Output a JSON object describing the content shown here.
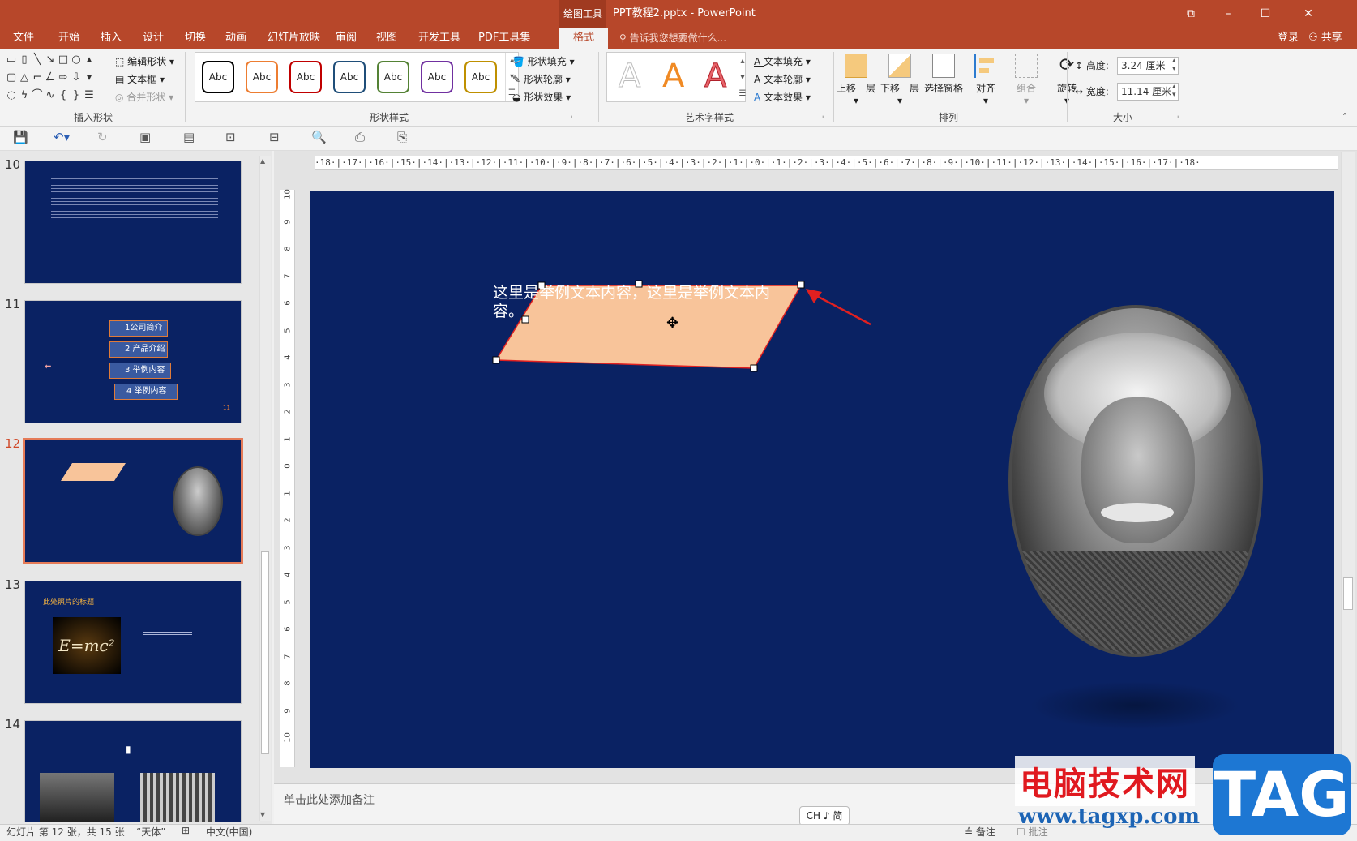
{
  "titlebar": {
    "context_tab": "绘图工具",
    "doc_title": "PPT教程2.pptx - PowerPoint",
    "restore_icon": "ribbon-display-icon",
    "minimize": "–",
    "maximize": "☐",
    "close": "✕"
  },
  "tabs": [
    "文件",
    "开始",
    "插入",
    "设计",
    "切换",
    "动画",
    "幻灯片放映",
    "审阅",
    "视图",
    "开发工具",
    "PDF工具集"
  ],
  "active_tab": "格式",
  "tellme": "告诉我您想要做什么...",
  "login": "登录",
  "share": "共享",
  "ribbon": {
    "insert_shapes": {
      "label": "插入形状",
      "edit_shape": "编辑形状",
      "textbox": "文本框",
      "merge_shapes": "合并形状"
    },
    "shape_styles": {
      "label": "形状样式",
      "sample": "Abc",
      "fill": "形状填充",
      "outline": "形状轮廓",
      "effects": "形状效果",
      "swatch_colors": [
        "#000000",
        "#ed7d31",
        "#c00000",
        "#1f4e79",
        "#548235",
        "#7030a0",
        "#bf9000"
      ]
    },
    "wordart": {
      "label": "艺术字样式",
      "letter": "A",
      "text_fill": "文本填充",
      "text_outline": "文本轮廓",
      "text_effects": "文本效果"
    },
    "arrange": {
      "label": "排列",
      "bring_forward": "上移一层",
      "send_backward": "下移一层",
      "selection_pane": "选择窗格",
      "align": "对齐",
      "group": "组合",
      "rotate": "旋转"
    },
    "size": {
      "label": "大小",
      "height_label": "高度:",
      "height": "3.24 厘米",
      "width_label": "宽度:",
      "width": "11.14 厘米"
    }
  },
  "thumbnails": [
    {
      "num": "10"
    },
    {
      "num": "11",
      "items": [
        "1公司简介",
        "2 产品介绍",
        "3 举例内容",
        "4 举例内容"
      ],
      "page_no": "11"
    },
    {
      "num": "12",
      "selected": true
    },
    {
      "num": "13",
      "title": "此处照片的标题",
      "formula": "E=mc²"
    },
    {
      "num": "14"
    }
  ],
  "ruler": {
    "h": "·18·|·17·|·16·|·15·|·14·|·13·|·12·|·11·|·10·|·9·|·8·|·7·|·6·|·5·|·4·|·3·|·2·|·1·|·0·|·1·|·2·|·3·|·4·|·5·|·6·|·7·|·8·|·9·|·10·|·11·|·12·|·13·|·14·|·15·|·16·|·17·|·18·",
    "v": [
      "10",
      "9",
      "8",
      "7",
      "6",
      "5",
      "4",
      "3",
      "2",
      "1",
      "0",
      "1",
      "2",
      "3",
      "4",
      "5",
      "6",
      "7",
      "8",
      "9",
      "10"
    ]
  },
  "slide": {
    "bg": "#0a2263",
    "shape_text": "这里是举例文本内容，这里是举例文本内容。",
    "shape_fill": "#f8c49a",
    "shape_outline": "#e02020"
  },
  "notes_placeholder": "单击此处添加备注",
  "ime": "CH ♪ 简",
  "status": {
    "slide_info": "幻灯片 第 12 张，共 15 张",
    "theme": "“天体”",
    "language": "中文(中国)",
    "notes": "备注",
    "comments": "批注"
  },
  "watermark": {
    "cn": "电脑技术网",
    "url": "www.tagxp.com",
    "tag": "TAG"
  }
}
